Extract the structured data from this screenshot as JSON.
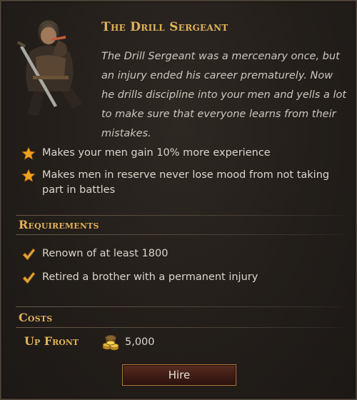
{
  "title": "The Drill Sergeant",
  "description": "The Drill Sergeant was a mercenary once, but an injury ended his career prematurely. Now he drills discipline into your men and yells a lot to make sure that everyone learns from their mistakes.",
  "effects": [
    {
      "icon": "star-icon",
      "text": "Makes your men gain 10% more experience"
    },
    {
      "icon": "star-icon",
      "text": "Makes men in reserve never lose mood from not taking part in battles"
    }
  ],
  "requirements": {
    "title": "Requirements",
    "items": [
      {
        "icon": "checkmark-icon",
        "text": "Renown of at least 1800"
      },
      {
        "icon": "checkmark-icon",
        "text": "Retired a brother with a permanent injury"
      }
    ]
  },
  "costs": {
    "title": "Costs",
    "up_front_label": "Up Front",
    "icon": "crowns-coins-icon",
    "up_front_value": "5,000"
  },
  "hire_button": "Hire",
  "colors": {
    "heading_gold": "#e0b25a",
    "star_gold": "#f0a020",
    "button_red": "#4a2219"
  }
}
